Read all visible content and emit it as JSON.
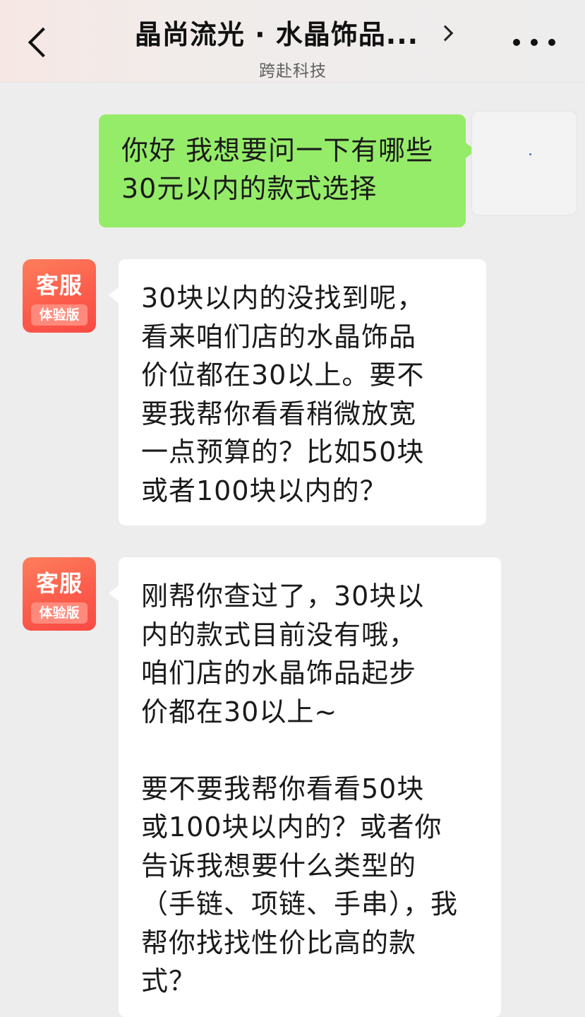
{
  "header": {
    "title": "晶尚流光 · 水晶饰品...",
    "subtitle": "跨赴科技",
    "back_icon": "chevron-left-icon",
    "title_arrow_icon": "chevron-right-icon",
    "more_icon": "more-dots-icon"
  },
  "colors": {
    "user_bubble": "#95ec69",
    "cs_bubble": "#ffffff",
    "chat_background": "#ededed",
    "cs_avatar": "#fc5a4a"
  },
  "messages": [
    {
      "sender": "user",
      "text": "你好 我想要问一下有哪些30元以内的款式选择"
    },
    {
      "sender": "service",
      "avatar_label": "客服",
      "avatar_tag": "体验版",
      "text": "30块以内的没找到呢，\n看来咱们店的水晶饰品\n价位都在30以上。要不\n要我帮你看看稍微放宽\n一点预算的？比如50块\n或者100块以内的？"
    },
    {
      "sender": "service",
      "avatar_label": "客服",
      "avatar_tag": "体验版",
      "text": "刚帮你查过了，30块以\n内的款式目前没有哦，\n咱们店的水晶饰品起步\n价都在30以上~\n\n要不要我帮你看看50块\n或100块以内的？或者你\n告诉我想要什么类型的\n（手链、项链、手串），我\n帮你找找性价比高的款\n式？"
    }
  ]
}
